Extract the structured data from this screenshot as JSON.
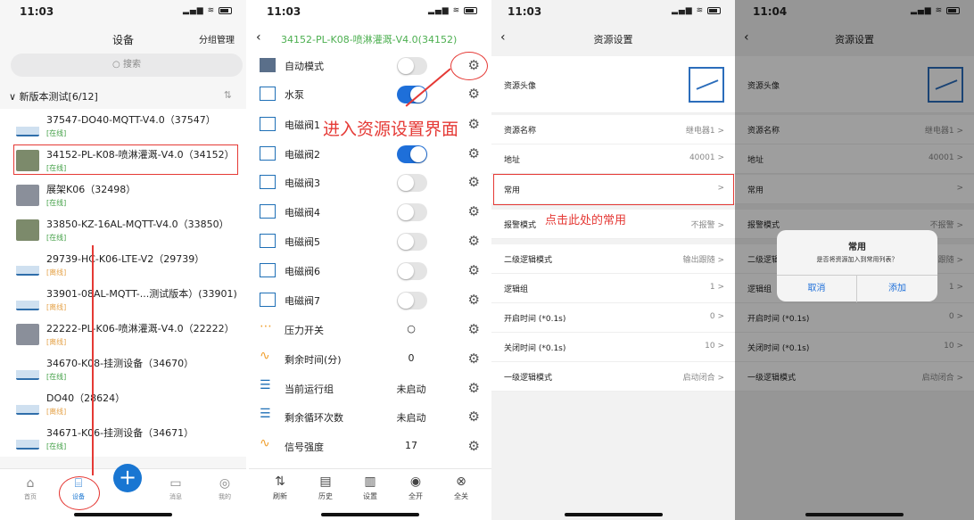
{
  "status": {
    "time1": "11:03",
    "time2": "11:03",
    "time3": "11:03",
    "time4": "11:04"
  },
  "p1": {
    "title": "设备",
    "group": "分组管理",
    "search": "搜索",
    "section": "新版本测试[6/12]",
    "devices": [
      {
        "name": "37547-DO40-MQTT-V4.0（37547）",
        "status": "[在线]"
      },
      {
        "name": "34152-PL-K08-喷淋灌溉-V4.0（34152）",
        "status": "[在线]"
      },
      {
        "name": "展架K06（32498）",
        "status": "[在线]"
      },
      {
        "name": "33850-KZ-16AL-MQTT-V4.0（33850）",
        "status": "[在线]"
      },
      {
        "name": "29739-HC-K06-LTE-V2（29739）",
        "status": "[离线]"
      },
      {
        "name": "33901-08AL-MQTT-...测试版本）(33901)",
        "status": "[离线]"
      },
      {
        "name": "22222-PL-K06-喷淋灌溉-V4.0（22222）",
        "status": "[离线]"
      },
      {
        "name": "34670-K08-挂测设备（34670）",
        "status": "[在线]"
      },
      {
        "name": "DO40（28624）",
        "status": "[离线]"
      },
      {
        "name": "34671-K06-挂测设备（34671）",
        "status": "[在线]"
      }
    ],
    "tabs": [
      "首页",
      "设备",
      "",
      "消息",
      "我的"
    ]
  },
  "p2": {
    "title": "34152-PL-K08-喷淋灌溉-V4.0(34152)",
    "rows": [
      {
        "label": "自动模式"
      },
      {
        "label": "水泵"
      },
      {
        "label": "电磁阀1"
      },
      {
        "label": "电磁阀2"
      },
      {
        "label": "电磁阀3"
      },
      {
        "label": "电磁阀4"
      },
      {
        "label": "电磁阀5"
      },
      {
        "label": "电磁阀6"
      },
      {
        "label": "电磁阀7"
      },
      {
        "label": "压力开关"
      },
      {
        "label": "剩余时间(分)",
        "value": "0"
      },
      {
        "label": "当前运行组",
        "value": "未启动"
      },
      {
        "label": "剩余循环次数",
        "value": "未启动"
      },
      {
        "label": "信号强度",
        "value": "17"
      }
    ],
    "annotation": "进入资源设置界面",
    "bottom": [
      "刷新",
      "历史",
      "设置",
      "全开",
      "全关"
    ]
  },
  "p3": {
    "title": "资源设置",
    "items": [
      {
        "k": "资源头像",
        "v": ""
      },
      {
        "k": "资源名称",
        "v": "继电器1 >"
      },
      {
        "k": "地址",
        "v": "40001 >"
      },
      {
        "k": "常用",
        "v": ">"
      },
      {
        "k": "报警模式",
        "v": "不报警 >"
      },
      {
        "k": "二级逻辑模式",
        "v": "输出跟随 >"
      },
      {
        "k": "逻辑组",
        "v": "1 >"
      },
      {
        "k": "开启时间 (*0.1s)",
        "v": "0 >"
      },
      {
        "k": "关闭时间 (*0.1s)",
        "v": "10 >"
      },
      {
        "k": "一级逻辑模式",
        "v": "启动闭合 >"
      }
    ],
    "annotation": "点击此处的常用"
  },
  "p4": {
    "title": "资源设置",
    "items": [
      {
        "k": "资源头像",
        "v": ""
      },
      {
        "k": "资源名称",
        "v": "继电器1 >"
      },
      {
        "k": "地址",
        "v": "40001 >"
      },
      {
        "k": "常用",
        "v": ">"
      },
      {
        "k": "报警模式",
        "v": "不报警 >"
      },
      {
        "k": "二级逻辑模式",
        "v": "跟随 >"
      },
      {
        "k": "逻辑组",
        "v": "1 >"
      },
      {
        "k": "开启时间 (*0.1s)",
        "v": "0 >"
      },
      {
        "k": "关闭时间 (*0.1s)",
        "v": "10 >"
      },
      {
        "k": "一级逻辑模式",
        "v": "启动闭合 >"
      }
    ],
    "dialog": {
      "title": "常用",
      "message": "是否将资源加入到常用列表？",
      "cancel": "取消",
      "confirm": "添加"
    }
  }
}
